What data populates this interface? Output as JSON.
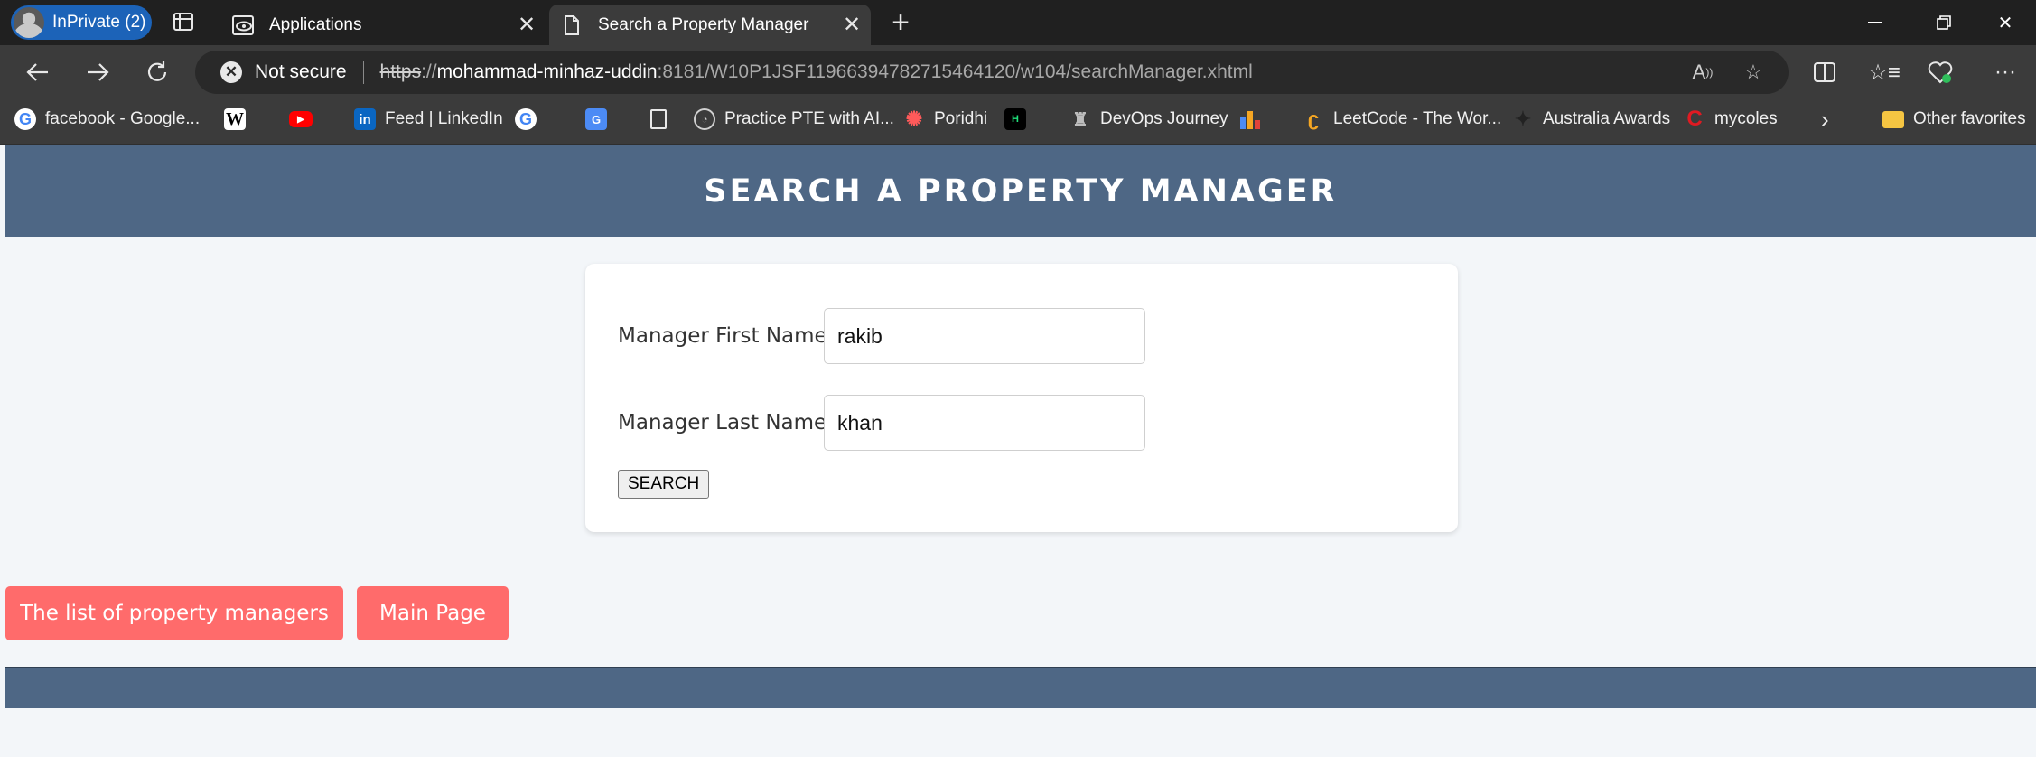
{
  "browser": {
    "inprivate_label": "InPrivate (2)",
    "tabs": [
      {
        "title": "Applications",
        "favicon": "eye-logo-icon"
      },
      {
        "title": "Search a Property Manager",
        "favicon": "document-icon"
      }
    ],
    "security_label": "Not secure",
    "url": {
      "protocol": "https",
      "separator": "://",
      "host": "mohammad-minhaz-uddin",
      "path": ":8181/W10P1JSF11966394782715464120/w104/searchManager.xhtml"
    },
    "favorites": [
      {
        "label": "facebook - Google...",
        "icon": "google-icon"
      },
      {
        "label": "",
        "icon": "wikipedia-icon"
      },
      {
        "label": "",
        "icon": "youtube-icon"
      },
      {
        "label": "Feed | LinkedIn",
        "icon": "linkedin-icon"
      },
      {
        "label": "",
        "icon": "google-icon"
      },
      {
        "label": "",
        "icon": "google-translate-icon"
      },
      {
        "label": "",
        "icon": "document-icon"
      },
      {
        "label": "Practice PTE with AI...",
        "icon": "pte-icon"
      },
      {
        "label": "Poridhi",
        "icon": "poridhi-icon"
      },
      {
        "label": "",
        "icon": "hackerrank-icon"
      },
      {
        "label": "DevOps Journey",
        "icon": "devops-icon"
      },
      {
        "label": "",
        "icon": "bar-chart-icon"
      },
      {
        "label": "LeetCode - The Wor...",
        "icon": "leetcode-icon"
      },
      {
        "label": "Australia Awards",
        "icon": "australia-awards-icon"
      },
      {
        "label": "mycoles",
        "icon": "coles-icon"
      }
    ],
    "other_favorites_label": "Other favorites"
  },
  "page": {
    "header_title": "SEARCH A PROPERTY MANAGER",
    "form": {
      "first_name_label": "Manager First Name:",
      "first_name_value": "rakib",
      "last_name_label": "Manager Last Name:",
      "last_name_value": "khan",
      "search_button": "SEARCH"
    },
    "links": {
      "list_managers": "The list of property managers",
      "main_page": "Main Page"
    }
  },
  "colors": {
    "header_bg": "#4e6785",
    "link_button_bg": "#ff6b6b",
    "page_bg": "#f3f6f9"
  }
}
